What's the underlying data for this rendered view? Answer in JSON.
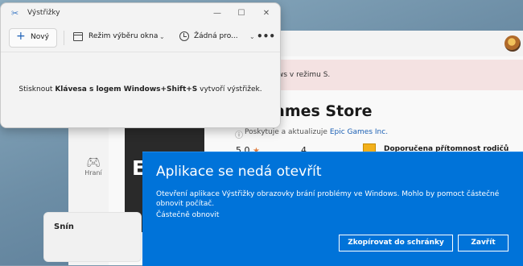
{
  "snipping_tool": {
    "title": "Výstřižky",
    "new_label": "Nový",
    "mode_label": "Režim výběru okna",
    "delay_label": "Žádná pro...",
    "more": "•••",
    "controls": {
      "minimize": "—",
      "maximize": "☐",
      "close": "✕"
    },
    "hint_prefix": "Stisknout ",
    "hint_keys": "Klávesa s logem Windows+Shift+S",
    "hint_suffix": " vytvoří výstřižek."
  },
  "store": {
    "smode_text": "ws v režimu S.",
    "app_title": "ames Store",
    "publisher_prefix": "Poskytuje a aktualizuje ",
    "publisher_name": "Epic Games Inc.",
    "tile_logo": "EPIC",
    "rating": "5,0",
    "age": "4",
    "parental": "Doporučena přítomnost rodičů",
    "nav_games": "Hraní",
    "bottom_title": "Snín"
  },
  "dialog": {
    "title": "Aplikace se nedá otevřít",
    "message": "Otevření aplikace Výstřižky obrazovky brání problémy ve Windows. Mohlo by pomoct částečné obnovit počítač.",
    "link": "Částečně obnovit",
    "copy_button": "Zkopírovat do schránky",
    "close_button": "Zavřít"
  },
  "colors": {
    "dialog_bg": "#0073d9",
    "accent": "#1b5fb5",
    "star": "#e07b3c"
  }
}
